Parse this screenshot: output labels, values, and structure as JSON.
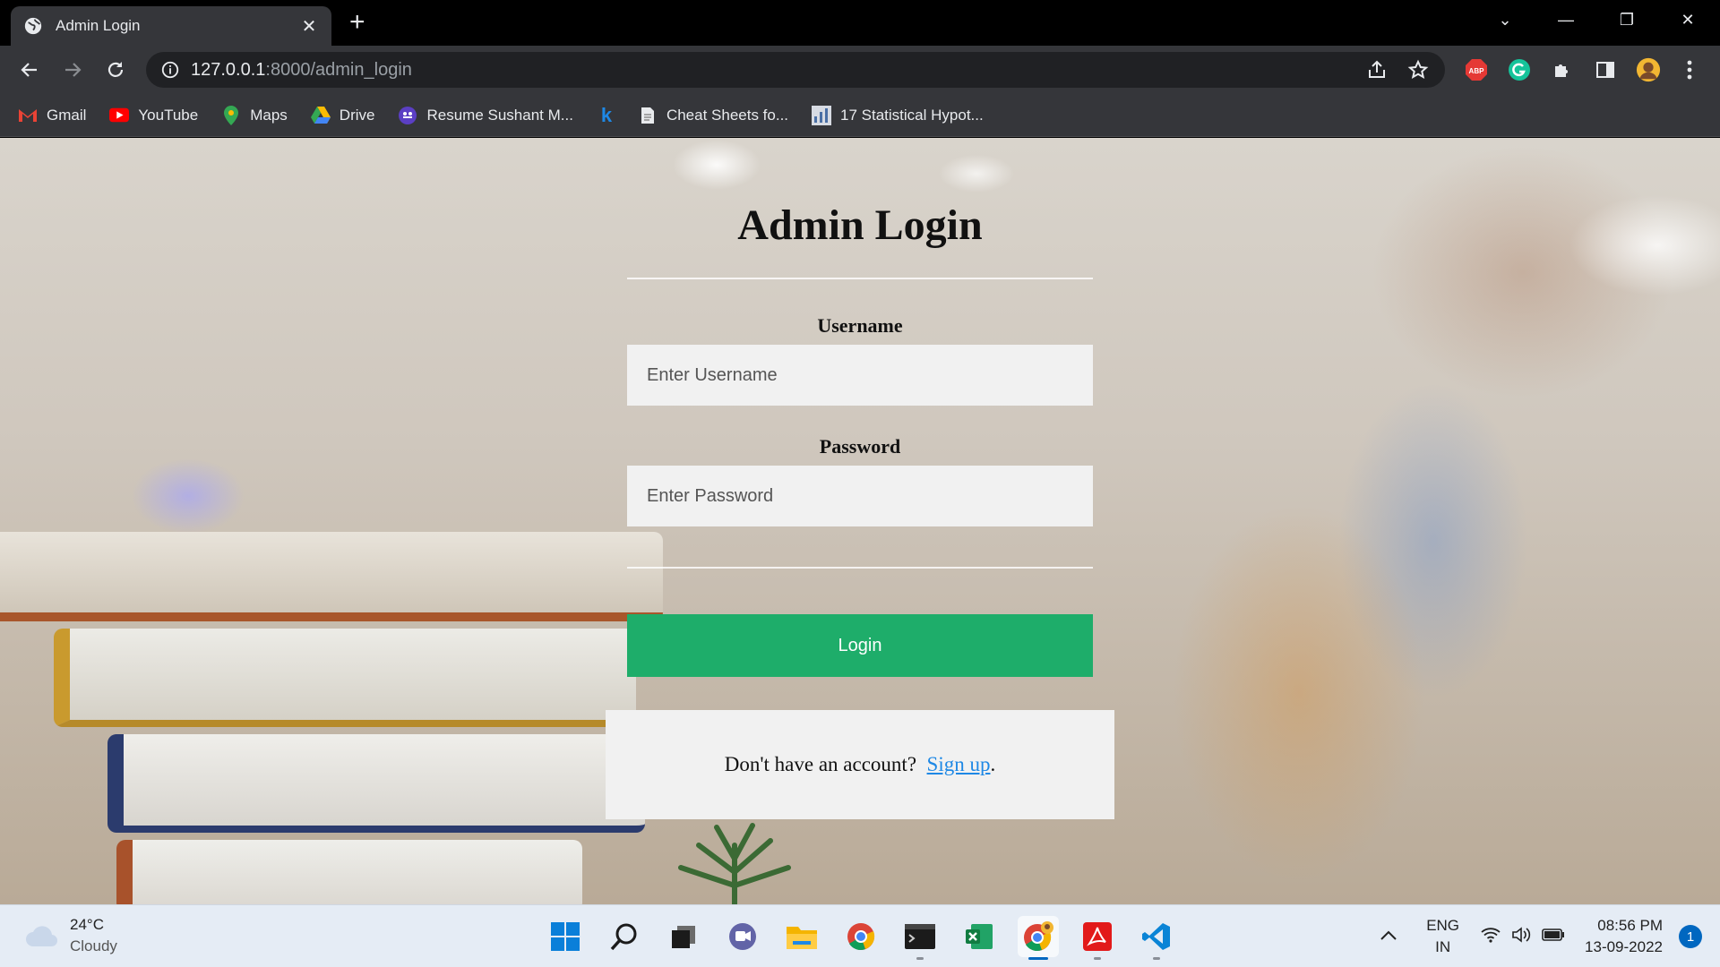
{
  "browser": {
    "tab_title": "Admin Login",
    "url_host": "127.0.0.1",
    "url_rest": ":8000/admin_login",
    "bookmarks": [
      "Gmail",
      "YouTube",
      "Maps",
      "Drive",
      "Resume Sushant M...",
      "Cheat Sheets fo...",
      "17 Statistical Hypot..."
    ]
  },
  "page": {
    "title": "Admin Login",
    "username_label": "Username",
    "username_placeholder": "Enter Username",
    "password_label": "Password",
    "password_placeholder": "Enter Password",
    "login_label": "Login",
    "signup_prefix": "Don't have an account? ",
    "signup_link": "Sign up",
    "signup_suffix": "."
  },
  "taskbar": {
    "temperature": "24°C",
    "condition": "Cloudy",
    "lang_top": "ENG",
    "lang_bottom": "IN",
    "time": "08:56 PM",
    "date": "13-09-2022",
    "notifications": "1"
  },
  "colors": {
    "login_button": "#1ead6a",
    "link": "#1e88e5"
  }
}
